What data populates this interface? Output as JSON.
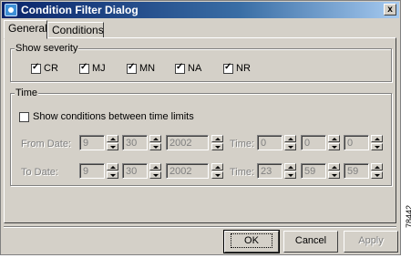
{
  "window": {
    "title": "Condition Filter Dialog",
    "close_label": "x"
  },
  "tabs": [
    {
      "label": "General"
    },
    {
      "label": "Conditions"
    }
  ],
  "severity": {
    "legend": "Show severity",
    "items": [
      {
        "label": "CR",
        "checked": true
      },
      {
        "label": "MJ",
        "checked": true
      },
      {
        "label": "MN",
        "checked": true
      },
      {
        "label": "NA",
        "checked": true
      },
      {
        "label": "NR",
        "checked": true
      }
    ]
  },
  "time": {
    "legend": "Time",
    "limits_label": "Show conditions between time limits",
    "limits_checked": false,
    "from": {
      "date_label": "From Date:",
      "month": "9",
      "day": "30",
      "year": "2002",
      "time_label": "Time:",
      "h": "0",
      "m": "0",
      "s": "0"
    },
    "to": {
      "date_label": "To Date:",
      "month": "9",
      "day": "30",
      "year": "2002",
      "time_label": "Time:",
      "h": "23",
      "m": "59",
      "s": "59"
    }
  },
  "buttons": {
    "ok": "OK",
    "cancel": "Cancel",
    "apply": "Apply"
  },
  "figure_id": "78442"
}
